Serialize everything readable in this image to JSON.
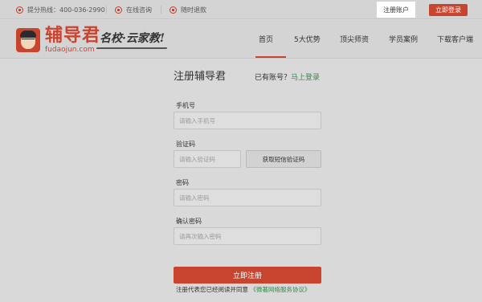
{
  "topbar": {
    "hotline_label": "提分热线：400-036-2990",
    "consult_label": "在线咨询",
    "refund_label": "随时退款",
    "register_label": "注册账户",
    "login_label": "立即登录"
  },
  "brand": {
    "name": "辅导君",
    "domain": "fudaojun.com",
    "slogan": "名校·云家教!",
    "accent_color": "#c9442f"
  },
  "nav": {
    "items": [
      {
        "label": "首页",
        "active": true
      },
      {
        "label": "5大优势",
        "active": false
      },
      {
        "label": "顶尖师资",
        "active": false
      },
      {
        "label": "学员案例",
        "active": false
      },
      {
        "label": "下载客户端",
        "active": false
      }
    ]
  },
  "form": {
    "title": "注册辅导君",
    "have_account": "已有账号？",
    "login_link": "马上登录",
    "phone_label": "手机号",
    "phone_placeholder": "请输入手机号",
    "code_label": "验证码",
    "code_placeholder": "请输入验证码",
    "get_code_label": "获取短信验证码",
    "password_label": "密码",
    "password_placeholder": "请输入密码",
    "confirm_label": "确认密码",
    "confirm_placeholder": "请再次输入密码",
    "submit_label": "立即注册",
    "agreement_prefix": "注册代表您已经阅读并同意",
    "agreement_link": "《微著网络服务协议》"
  }
}
